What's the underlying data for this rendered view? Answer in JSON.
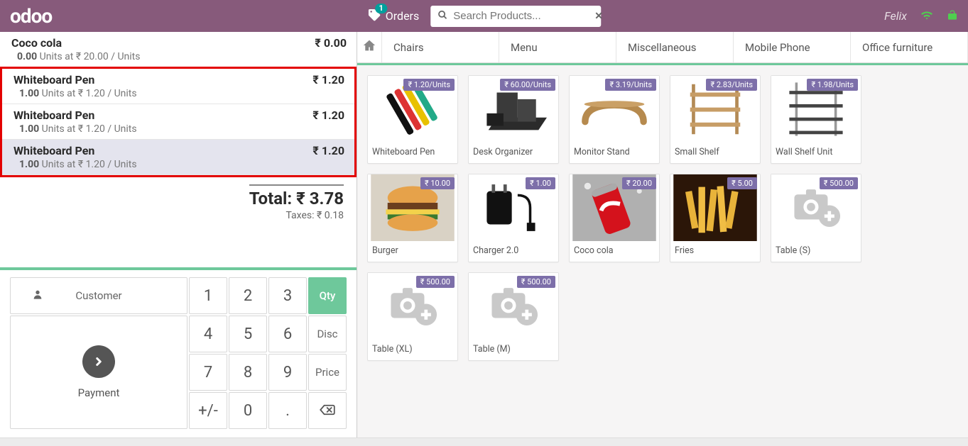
{
  "topbar": {
    "logo": "odoo",
    "orders_label": "Orders",
    "orders_badge": "1",
    "search_placeholder": "Search Products...",
    "username": "Felix"
  },
  "order": {
    "lines": [
      {
        "name": "Coco cola",
        "qty": "0.00",
        "unit_price": "20.00",
        "unit": "Units",
        "line_total": "₹ 0.00",
        "selected": false,
        "highlight": false
      },
      {
        "name": "Whiteboard Pen",
        "qty": "1.00",
        "unit_price": "1.20",
        "unit": "Units",
        "line_total": "₹ 1.20",
        "selected": false,
        "highlight": true
      },
      {
        "name": "Whiteboard Pen",
        "qty": "1.00",
        "unit_price": "1.20",
        "unit": "Units",
        "line_total": "₹ 1.20",
        "selected": false,
        "highlight": true
      },
      {
        "name": "Whiteboard Pen",
        "qty": "1.00",
        "unit_price": "1.20",
        "unit": "Units",
        "line_total": "₹ 1.20",
        "selected": true,
        "highlight": true
      }
    ],
    "currency": "₹",
    "total_label": "Total:",
    "total_value": "₹ 3.78",
    "taxes_label": "Taxes:",
    "taxes_value": "₹ 0.18"
  },
  "keypad": {
    "customer_label": "Customer",
    "payment_label": "Payment",
    "keys": {
      "1": "1",
      "2": "2",
      "3": "3",
      "4": "4",
      "5": "5",
      "6": "6",
      "7": "7",
      "8": "8",
      "9": "9",
      "pm": "+/-",
      "0": "0",
      "dot": "."
    },
    "mode_qty": "Qty",
    "mode_disc": "Disc",
    "mode_price": "Price",
    "backspace": "⌫"
  },
  "categories": [
    "Chairs",
    "Menu",
    "Miscellaneous",
    "Mobile Phone",
    "Office furniture"
  ],
  "products": [
    {
      "name": "Whiteboard Pen",
      "price": "₹ 1.20/Units",
      "thumb": "pens"
    },
    {
      "name": "Desk Organizer",
      "price": "₹ 60.00/Units",
      "thumb": "organizer"
    },
    {
      "name": "Monitor Stand",
      "price": "₹ 3.19/Units",
      "thumb": "stand"
    },
    {
      "name": "Small Shelf",
      "price": "₹ 2.83/Units",
      "thumb": "smallshelf"
    },
    {
      "name": "Wall Shelf Unit",
      "price": "₹ 1.98/Units",
      "thumb": "wallshelf"
    },
    {
      "name": "Burger",
      "price": "₹ 10.00",
      "thumb": "burger"
    },
    {
      "name": "Charger 2.0",
      "price": "₹ 1.00",
      "thumb": "charger"
    },
    {
      "name": "Coco cola",
      "price": "₹ 20.00",
      "thumb": "cola"
    },
    {
      "name": "Fries",
      "price": "₹ 5.00",
      "thumb": "fries"
    },
    {
      "name": "Table (S)",
      "price": "₹ 500.00",
      "thumb": "placeholder"
    },
    {
      "name": "Table (XL)",
      "price": "₹ 500.00",
      "thumb": "placeholder"
    },
    {
      "name": "Table (M)",
      "price": "₹ 500.00",
      "thumb": "placeholder"
    }
  ]
}
